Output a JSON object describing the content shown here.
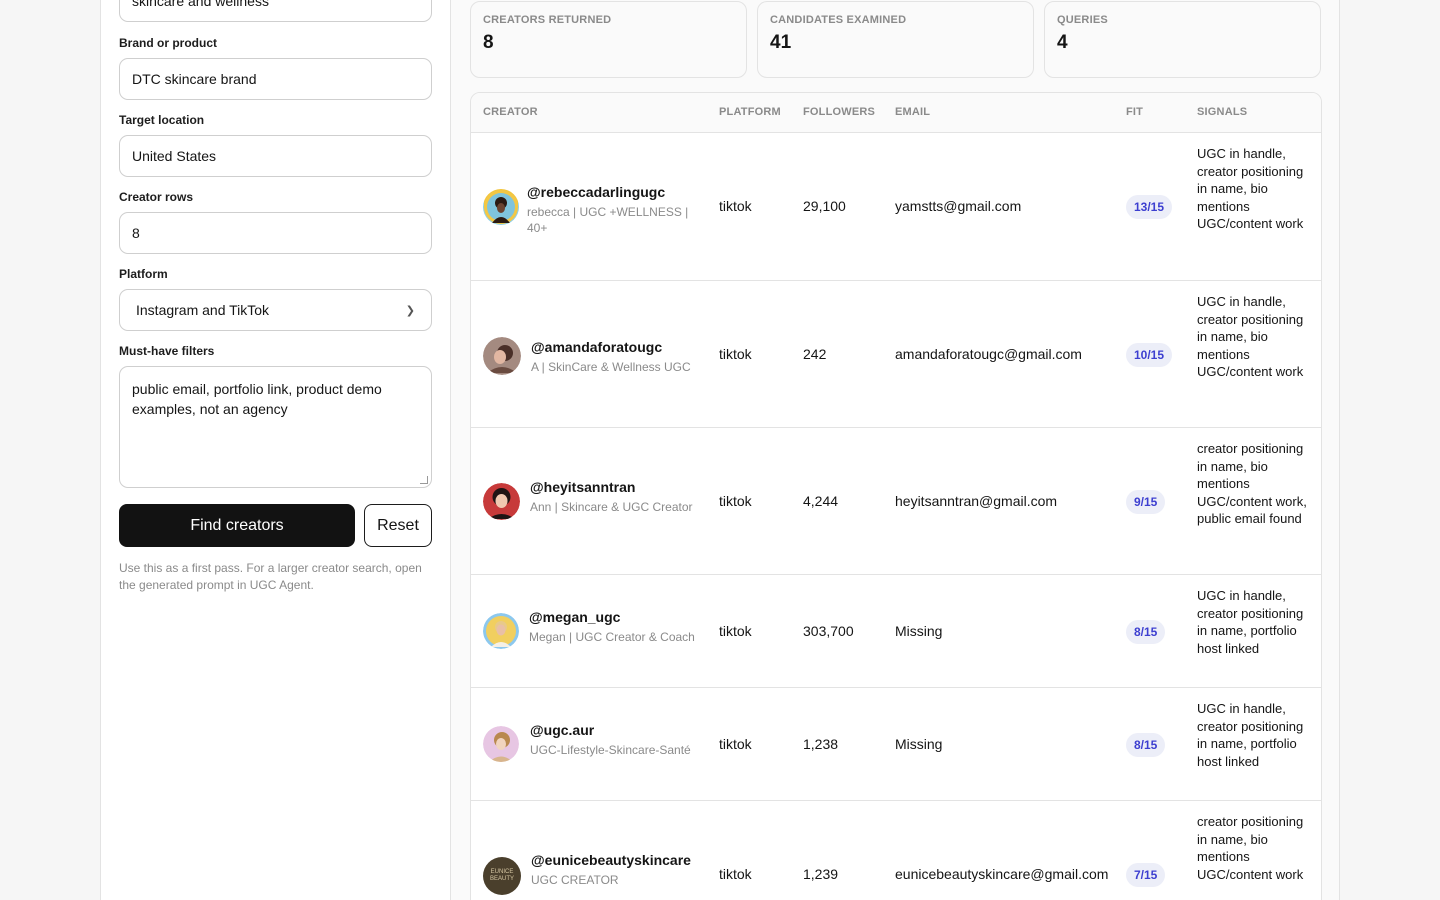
{
  "sidebar": {
    "niche_value": "skincare and wellness",
    "brand_label": "Brand or product",
    "brand_value": "DTC skincare brand",
    "location_label": "Target location",
    "location_value": "United States",
    "rows_label": "Creator rows",
    "rows_value": "8",
    "platform_label": "Platform",
    "platform_value": "Instagram and TikTok",
    "filters_label": "Must-have filters",
    "filters_value": "public email, portfolio link, product demo examples, not an agency",
    "find_button": "Find creators",
    "reset_button": "Reset",
    "hint": "Use this as a first pass. For a larger creator search, open the generated prompt in UGC Agent."
  },
  "stats": [
    {
      "label": "Creators returned",
      "value": "8"
    },
    {
      "label": "Candidates examined",
      "value": "41"
    },
    {
      "label": "Queries",
      "value": "4"
    }
  ],
  "table": {
    "headers": {
      "creator": "Creator",
      "platform": "Platform",
      "followers": "Followers",
      "email": "Email",
      "fit": "Fit",
      "signals": "Signals"
    },
    "rows": [
      {
        "handle": "@rebeccadarlingugc",
        "bio": "rebecca | UGC +WELLNESS | 40+",
        "platform": "tiktok",
        "followers": "29,100",
        "email": "yamstts@gmail.com",
        "fit": "13/15",
        "signals": "UGC in handle, creator positioning in name, bio mentions UGC/content work"
      },
      {
        "handle": "@amandaforatougc",
        "bio": "A | SkinCare & Wellness UGC",
        "platform": "tiktok",
        "followers": "242",
        "email": "amandaforatougc@gmail.com",
        "fit": "10/15",
        "signals": "UGC in handle, creator positioning in name, bio mentions UGC/content work"
      },
      {
        "handle": "@heyitsanntran",
        "bio": "Ann | Skincare & UGC Creator",
        "platform": "tiktok",
        "followers": "4,244",
        "email": "heyitsanntran@gmail.com",
        "fit": "9/15",
        "signals": "creator positioning in name, bio mentions UGC/content work, public email found"
      },
      {
        "handle": "@megan_ugc",
        "bio": "Megan | UGC Creator & Coach",
        "platform": "tiktok",
        "followers": "303,700",
        "email": "Missing",
        "fit": "8/15",
        "signals": "UGC in handle, creator positioning in name, portfolio host linked"
      },
      {
        "handle": "@ugc.aur",
        "bio": "UGC-Lifestyle-Skincare-Santé",
        "platform": "tiktok",
        "followers": "1,238",
        "email": "Missing",
        "fit": "8/15",
        "signals": "UGC in handle, creator positioning in name, portfolio host linked"
      },
      {
        "handle": "@eunicebeautyskincare",
        "bio": "UGC CREATOR",
        "avatar_text": "EUNICE BEAUTY",
        "platform": "tiktok",
        "followers": "1,239",
        "email": "eunicebeautyskincare@gmail.com",
        "fit": "7/15",
        "signals": "creator positioning in name, bio mentions UGC/content work"
      }
    ]
  },
  "colors": {
    "accent_pill_bg": "#eceef8",
    "accent_pill_text": "#3d3fd0",
    "primary_button": "#121212"
  }
}
